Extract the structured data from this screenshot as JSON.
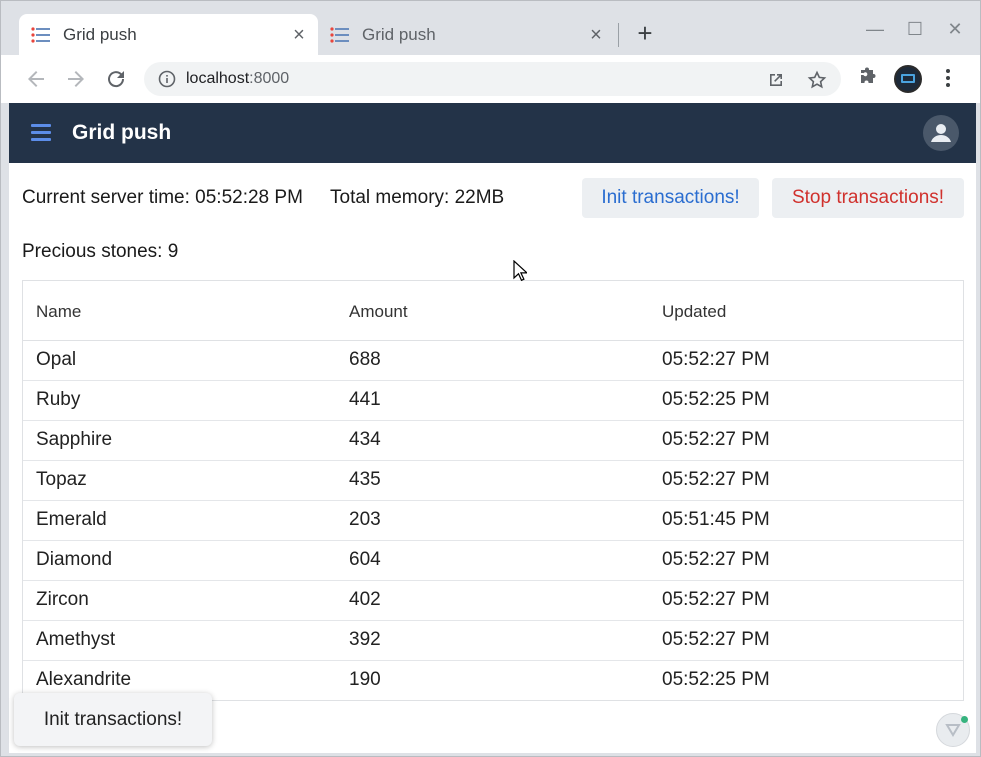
{
  "browser": {
    "tabs": [
      {
        "title": "Grid push",
        "active": true
      },
      {
        "title": "Grid push",
        "active": false
      }
    ],
    "url_host": "localhost",
    "url_port": ":8000"
  },
  "app": {
    "title": "Grid push",
    "server_time_label": "Current server time: 05:52:28 PM",
    "memory_label": "Total memory: 22MB",
    "init_button": "Init transactions!",
    "stop_button": "Stop transactions!",
    "stones_label": "Precious stones: 9",
    "toast": "Init transactions!"
  },
  "grid": {
    "columns": [
      "Name",
      "Amount",
      "Updated"
    ],
    "rows": [
      {
        "name": "Opal",
        "amount": "688",
        "updated": "05:52:27 PM"
      },
      {
        "name": "Ruby",
        "amount": "441",
        "updated": "05:52:25 PM"
      },
      {
        "name": "Sapphire",
        "amount": "434",
        "updated": "05:52:27 PM"
      },
      {
        "name": "Topaz",
        "amount": "435",
        "updated": "05:52:27 PM"
      },
      {
        "name": "Emerald",
        "amount": "203",
        "updated": "05:51:45 PM"
      },
      {
        "name": "Diamond",
        "amount": "604",
        "updated": "05:52:27 PM"
      },
      {
        "name": "Zircon",
        "amount": "402",
        "updated": "05:52:27 PM"
      },
      {
        "name": "Amethyst",
        "amount": "392",
        "updated": "05:52:27 PM"
      },
      {
        "name": "Alexandrite",
        "amount": "190",
        "updated": "05:52:25 PM"
      }
    ]
  },
  "colors": {
    "appbar": "#233348",
    "accent_blue": "#2a6dd0",
    "danger_red": "#d0312d"
  },
  "icons": [
    "favicon-icon",
    "close-icon",
    "new-tab-icon",
    "back-icon",
    "forward-icon",
    "reload-icon",
    "info-icon",
    "open-external-icon",
    "star-icon",
    "extensions-icon",
    "profile-avatar",
    "more-vert-icon",
    "menu-icon",
    "user-avatar-icon",
    "devtools-icon",
    "cursor-icon"
  ]
}
